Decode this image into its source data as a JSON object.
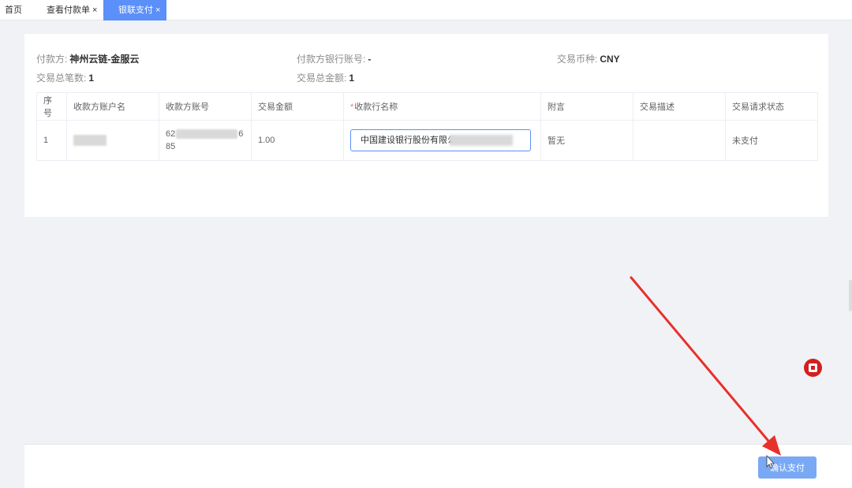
{
  "tabs": [
    {
      "label": "首页",
      "closable": false,
      "active": false
    },
    {
      "label": "查看付款单",
      "closable": true,
      "active": false
    },
    {
      "label": "银联支付",
      "closable": true,
      "active": true
    }
  ],
  "tab_close_glyph": "×",
  "summary": {
    "payer_label": "付款方:",
    "payer_value": "神州云链-金服云",
    "payer_account_label": "付款方银行账号:",
    "payer_account_value": "-",
    "currency_label": "交易币种:",
    "currency_value": "CNY",
    "total_count_label": "交易总笔数:",
    "total_count_value": "1",
    "total_amount_label": "交易总金额:",
    "total_amount_value": "1"
  },
  "table": {
    "headers": [
      "序号",
      "收款方账户名",
      "收款方账号",
      "交易金额",
      "收款行名称",
      "附言",
      "交易描述",
      "交易请求状态"
    ],
    "required_mark": "*",
    "rows": [
      {
        "index": "1",
        "account_name": "",
        "account_no_line1": "62",
        "account_no_line1_end": "6",
        "account_no_line2": "85",
        "amount": "1.00",
        "bank_name": "中国建设银行股份有限公",
        "postscript": "暂无",
        "description": "",
        "status": "未支付"
      }
    ]
  },
  "footer": {
    "confirm_label": "确认支付"
  },
  "colors": {
    "accent": "#5b8ff9",
    "confirm_button": "#79a9f5",
    "annotation_red": "#e8302a"
  },
  "icons": {
    "record": "record-stop-icon",
    "arrow": "annotation-arrow"
  }
}
